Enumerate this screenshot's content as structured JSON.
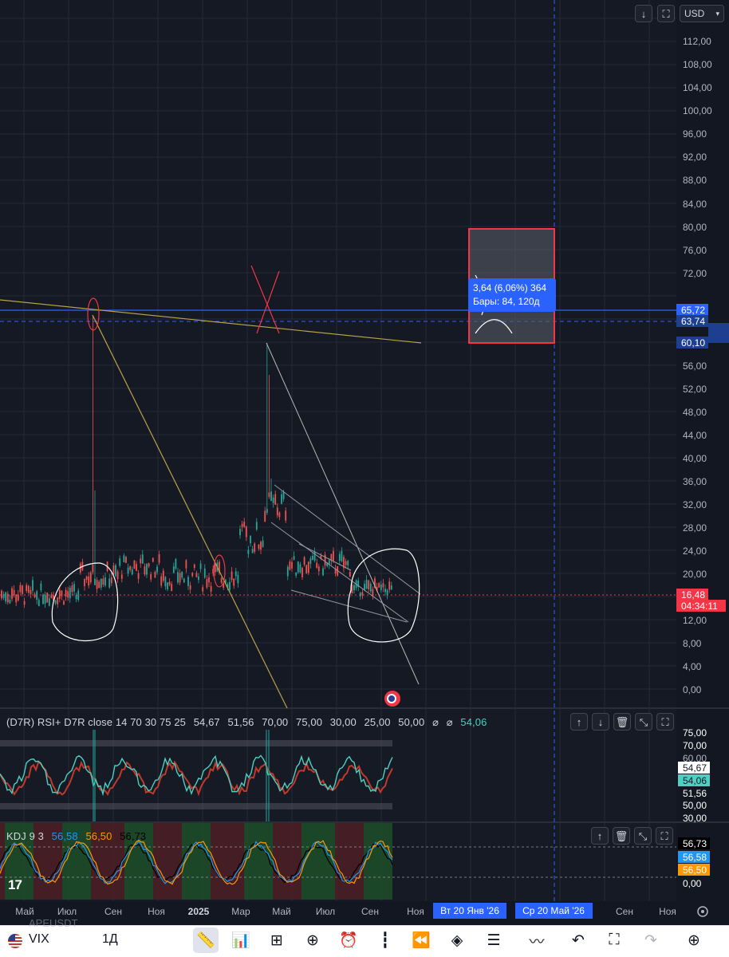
{
  "header": {
    "currency": "USD",
    "download_icon": "arrow-down-icon",
    "fullscreen_icon": "fullscreen-icon"
  },
  "price_axis": {
    "labels": [
      "112,00",
      "108,00",
      "104,00",
      "100,00",
      "96,00",
      "92,00",
      "88,00",
      "84,00",
      "80,00",
      "76,00",
      "72,00",
      "56,00",
      "52,00",
      "48,00",
      "44,00",
      "40,00",
      "36,00",
      "32,00",
      "28,00",
      "24,00",
      "20,00",
      "12,00",
      "8,00",
      "4,00",
      "0,00"
    ],
    "tags": [
      {
        "text": "65,72",
        "color": "#2962ff"
      },
      {
        "text": "63,74",
        "color": "#1e3f8f"
      },
      {
        "text": "60,10",
        "color": "#1e3f8f"
      },
      {
        "text": "16,48",
        "color": "#f23645"
      },
      {
        "text": "04:34:11",
        "color": "#f23645"
      }
    ]
  },
  "measure_tool": {
    "line1": "3,64 (6,06%) 364",
    "line2": "Бары: 84, 120д"
  },
  "rsi_pane": {
    "title": "(D7R) RSI+ D7R close 14 70 30 75 25",
    "values": [
      "54,67",
      "51,56",
      "70,00",
      "75,00",
      "30,00",
      "25,00",
      "50,00"
    ],
    "symbol": "⌀",
    "last_value": "54,06",
    "axis_labels": [
      "75,00",
      "70,00",
      "60,00",
      "54,67",
      "54,06",
      "51,56",
      "50,00",
      "30,00"
    ],
    "colors": {
      "rsi_up": "#4dd0c1",
      "rsi_down": "#c0392b",
      "last": "#26a69a"
    }
  },
  "kdj_pane": {
    "title": "KDJ 9 3",
    "k": "56,58",
    "d": "56,50",
    "j": "56,73",
    "axis_labels": [
      "56,73",
      "56,58",
      "56,50",
      "0,00"
    ],
    "colors": {
      "k": "#2196f3",
      "d": "#ff9800",
      "j": "#000000"
    }
  },
  "time_axis": {
    "labels": [
      "Май",
      "Июл",
      "Сен",
      "Ноя",
      "2025",
      "Мар",
      "Май",
      "Июл",
      "Сен",
      "Ноя",
      "Сен",
      "Ноя"
    ],
    "date_tags": [
      "Вт 20 Янв '26",
      "Ср 20 Май '26"
    ]
  },
  "bottom_bar": {
    "symbol": "VIX",
    "interval": "1Д",
    "ghost_text": "APEUSDT",
    "icons": [
      "ruler-icon",
      "chart-up-icon",
      "grid-icon",
      "plus-circle-icon",
      "alarm-icon",
      "candles-icon",
      "rewind-icon",
      "layers-icon",
      "settings-sliders-icon",
      "compare-icon",
      "undo-icon",
      "fullscreen-icon",
      "redo-icon",
      "add-user-icon"
    ]
  },
  "brand": "17"
}
